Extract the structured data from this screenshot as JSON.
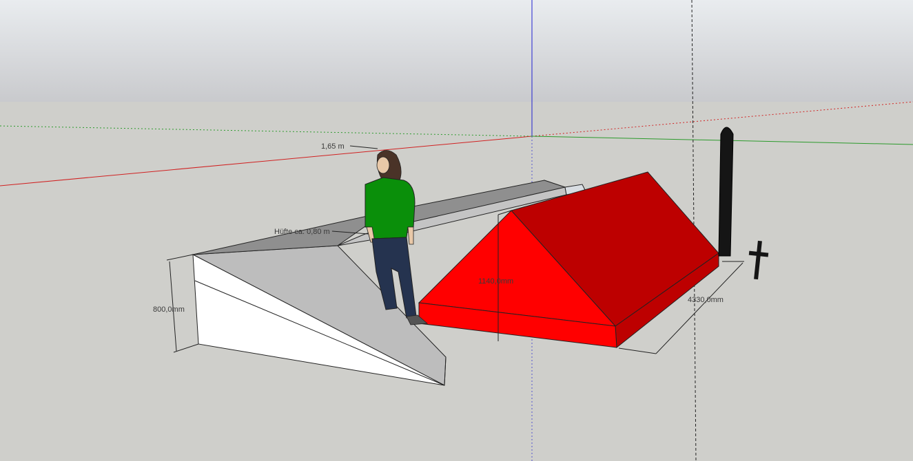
{
  "scene": {
    "colors": {
      "sky_top": "#e9ecef",
      "sky_bottom": "#c9cacd",
      "ground": "#cfcfcb",
      "roof_front": "#ff0000",
      "roof_side": "#bd0000",
      "ramp_side": "#ffffff",
      "ramp_top": "#bdbdbd",
      "ramp_far": "#8f8f8f",
      "person_shirt": "#0a8f0a",
      "person_pants": "#25334f",
      "x_axis": "#d02020",
      "y_axis": "#2a9a2a",
      "z_axis": "#2020d0",
      "pillar": "#151515"
    },
    "dimensions": {
      "person_height": "1,65 m",
      "hip_height": "Hüfte ca. 0,80 m",
      "ramp_height": "800,0mm",
      "roof_height": "1140,0mm",
      "roof_length": "4330,0mm"
    }
  }
}
